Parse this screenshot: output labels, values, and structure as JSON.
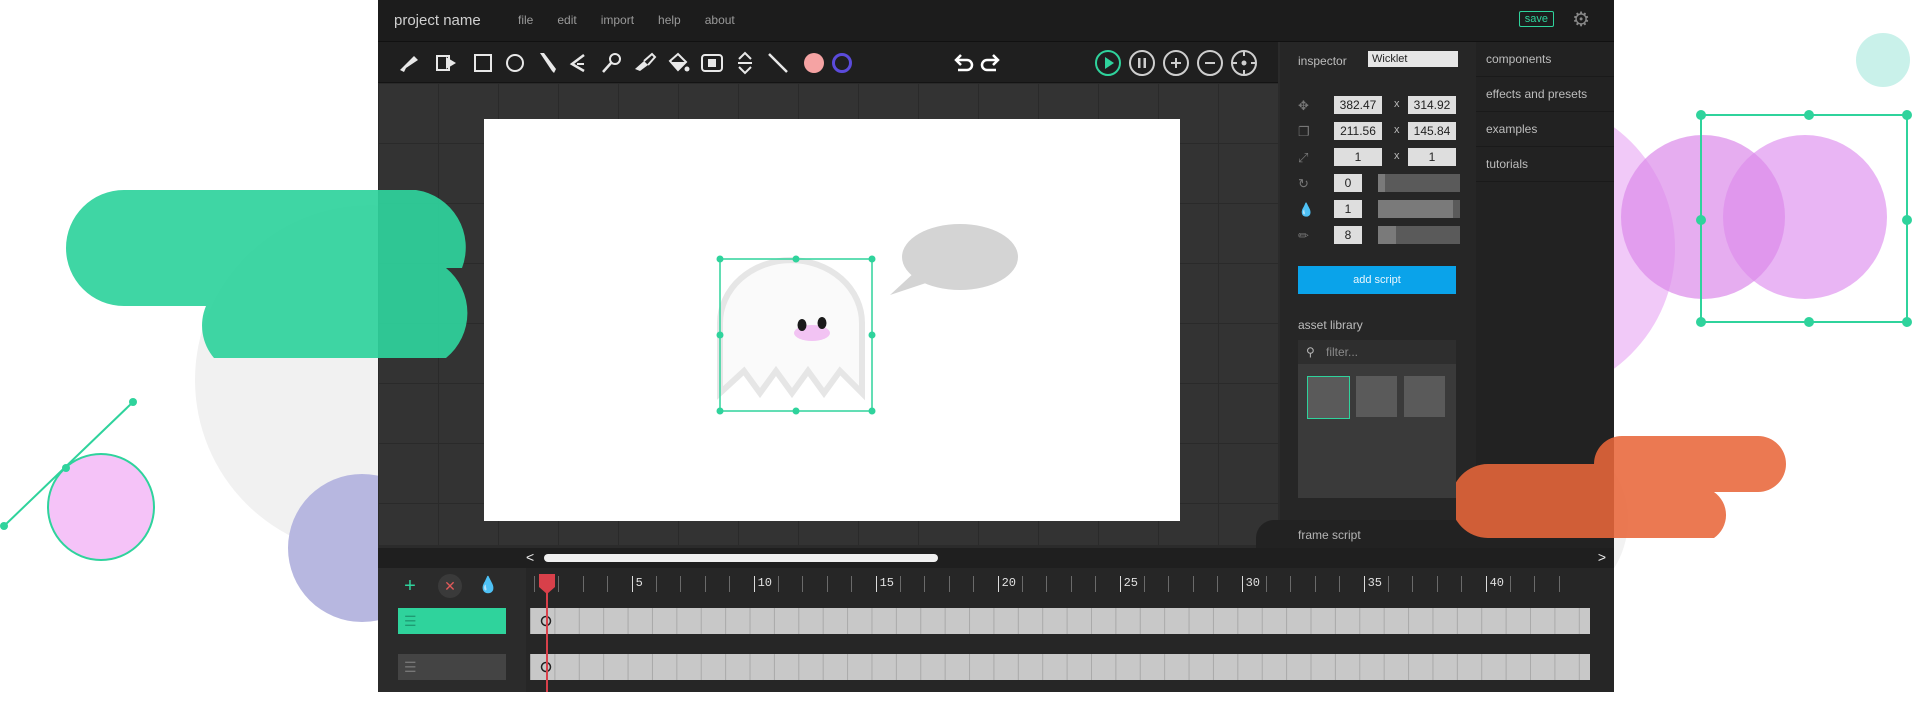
{
  "app": {
    "project_name": "project name",
    "menu": [
      "file",
      "edit",
      "import",
      "help",
      "about"
    ],
    "save_label": "save"
  },
  "toolbar": {
    "tools": [
      "cursor-icon",
      "path-select-icon",
      "rectangle-icon",
      "ellipse-icon",
      "pencil-icon",
      "text-icon",
      "eyedropper-icon",
      "brush-icon",
      "fill-bucket-icon",
      "image-icon",
      "flip-icon",
      "line-icon"
    ],
    "fill_color": "#f5a3a3",
    "stroke_color": "#5b4bdb",
    "history": [
      "undo-icon",
      "redo-icon"
    ],
    "playback": [
      "play-icon",
      "pause-icon",
      "zoom-in-icon",
      "zoom-out-icon",
      "recenter-icon"
    ]
  },
  "inspector": {
    "title": "inspector",
    "object_name": "Wicklet",
    "position": {
      "x": "382.47",
      "y": "314.92"
    },
    "size": {
      "w": "211.56",
      "h": "145.84"
    },
    "scale": {
      "x": "1",
      "y": "1"
    },
    "rotation": {
      "value": "0",
      "fraction": 0.08
    },
    "opacity": {
      "value": "1",
      "fraction": 0.92
    },
    "stroke_width": {
      "value": "8",
      "fraction": 0.22
    },
    "add_script_label": "add script",
    "asset_library_title": "asset library",
    "filter_placeholder": "filter...",
    "sep": "x"
  },
  "sidenav": {
    "items": [
      "components",
      "effects and presets",
      "examples",
      "tutorials"
    ]
  },
  "frame_script": {
    "label": "frame script"
  },
  "timeline": {
    "tick_labels": [
      "5",
      "10",
      "15",
      "20",
      "25",
      "30",
      "35",
      "40"
    ],
    "playhead_frame": 1
  },
  "colors": {
    "accent_green": "#2fd39c",
    "blue_button": "#0aa3ea",
    "playhead_red": "#d8404a",
    "deco_orange": "#e8673a",
    "deco_pink": "#e8a0f0",
    "deco_purple": "#9a9ad8"
  }
}
